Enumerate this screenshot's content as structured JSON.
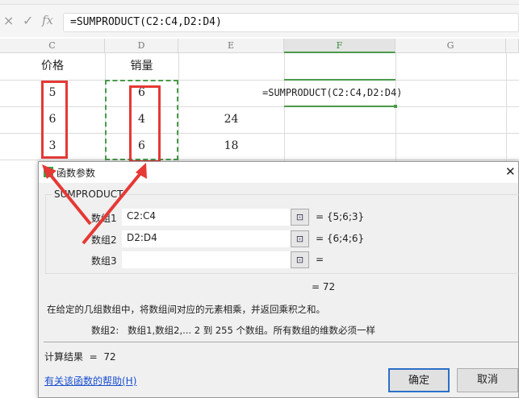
{
  "formula_bar": {
    "cancel_icon": "×",
    "confirm_icon": "✓",
    "fx_label": "fx",
    "formula": "=SUMPRODUCT(C2:C4,D2:D4)"
  },
  "columns": [
    "C",
    "D",
    "E",
    "F",
    "G"
  ],
  "cells": {
    "C1": "价格",
    "D1": "销量",
    "C2": "5",
    "D2": "6",
    "F2": "=SUMPRODUCT(C2:C4,D2:D4)",
    "C3": "6",
    "D3": "4",
    "E3": "24",
    "C4": "3",
    "D4": "6",
    "E4": "18"
  },
  "dialog": {
    "title": "函数参数",
    "close_icon": "✕",
    "function_name": "SUMPRODUCT",
    "args": [
      {
        "label": "数组1",
        "value": "C2:C4",
        "result": "= {5;6;3}"
      },
      {
        "label": "数组2",
        "value": "D2:D4",
        "result": "= {6;4;6}"
      },
      {
        "label": "数组3",
        "value": "",
        "result": "="
      }
    ],
    "formula_result": "= 72",
    "description": "在给定的几组数组中，将数组间对应的元素相乘，并返回乘积之和。",
    "arg_description": "数组2:   数组1,数组2,... 2 到 255 个数组。所有数组的维数必须一样",
    "calc_result": "计算结果  =  72",
    "help_link": "有关该函数的帮助(H)",
    "ok": "确定",
    "cancel": "取消"
  },
  "colors": {
    "annotation_red": "#e53935",
    "selection_green": "#4a9a4a"
  }
}
